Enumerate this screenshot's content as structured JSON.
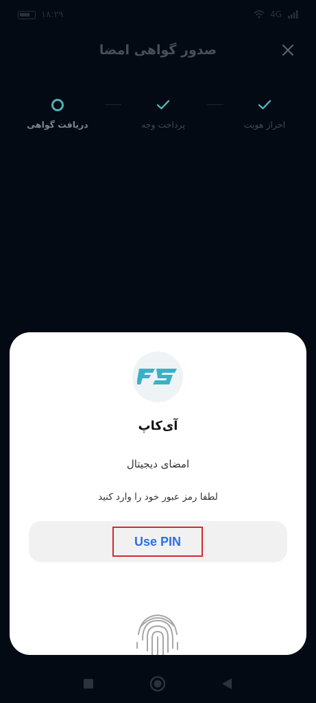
{
  "status_bar": {
    "time": "۱۸:۲۹",
    "network": "4G"
  },
  "header": {
    "title": "صدور گواهی امضا"
  },
  "stepper": {
    "steps": [
      {
        "label": "احراز هویت",
        "state": "done"
      },
      {
        "label": "پرداخت وجه",
        "state": "done"
      },
      {
        "label": "دریافت گواهی",
        "state": "active"
      }
    ]
  },
  "sheet": {
    "app_name": "آی‌کاپ",
    "subtitle": "امضای دیجیتال",
    "prompt": "لطفا رمز عبور خود را وارد کنید",
    "pin_button": "Use PIN"
  },
  "colors": {
    "background": "#040a13",
    "accent": "#4fb2b8",
    "pin_text": "#2f6fe0",
    "highlight": "#d12a2a"
  },
  "icons": {
    "close": "close-icon",
    "check": "check-icon",
    "fingerprint": "fingerprint-icon"
  }
}
